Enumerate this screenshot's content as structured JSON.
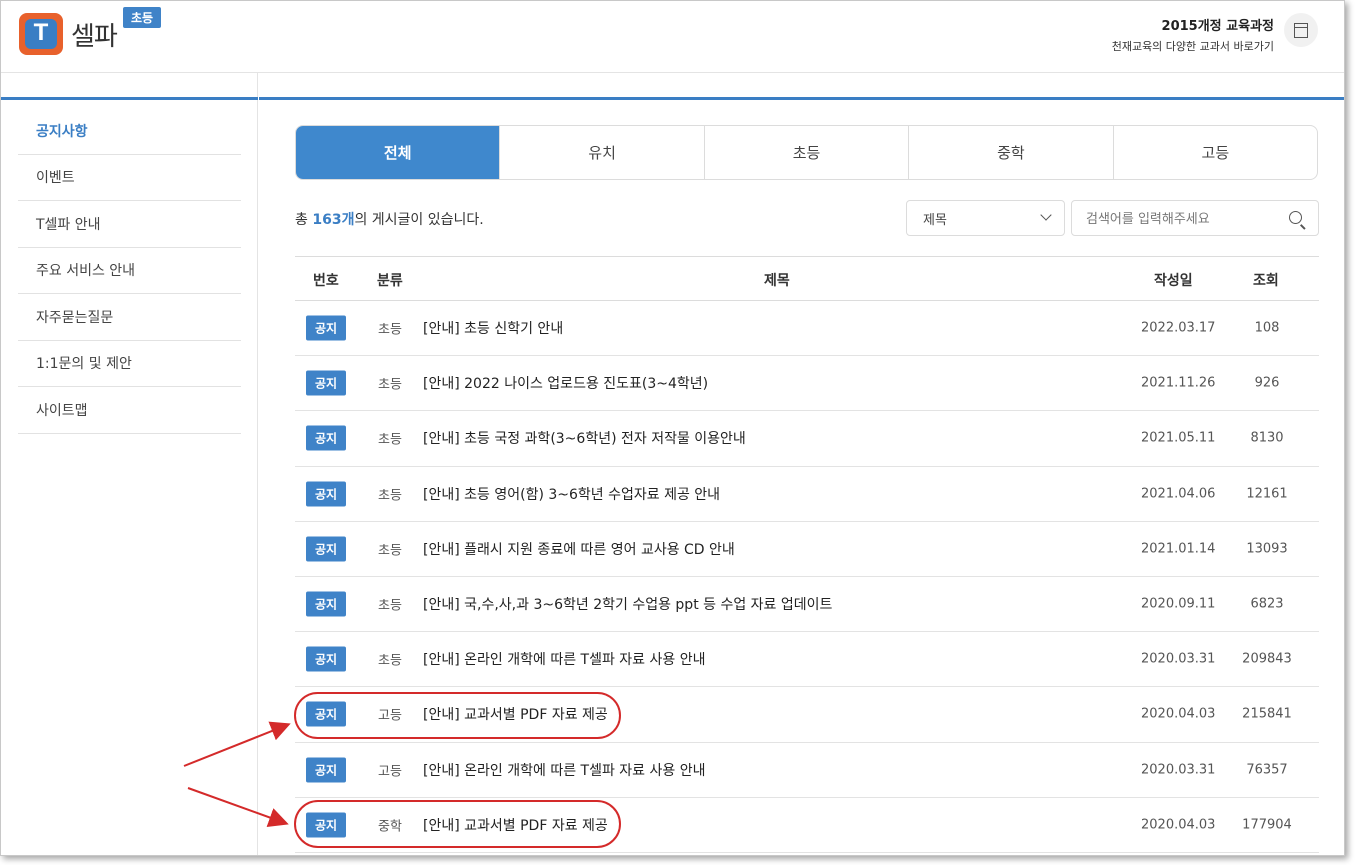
{
  "header": {
    "logo_letter": "T",
    "logo_text": "셀파",
    "level_badge": "초등",
    "curriculum_title": "2015개정 교육과정",
    "curriculum_sub": "천재교육의 다양한 교과서 바로가기"
  },
  "sidebar": {
    "items": [
      {
        "label": "공지사항",
        "active": true
      },
      {
        "label": "이벤트"
      },
      {
        "label": "T셀파 안내"
      },
      {
        "label": "주요 서비스 안내"
      },
      {
        "label": "자주묻는질문"
      },
      {
        "label": "1:1문의 및 제안"
      },
      {
        "label": "사이트맵"
      }
    ]
  },
  "tabs": [
    {
      "label": "전체",
      "active": true
    },
    {
      "label": "유치"
    },
    {
      "label": "초등"
    },
    {
      "label": "중학"
    },
    {
      "label": "고등"
    }
  ],
  "summary": {
    "prefix": "총 ",
    "count": "163개",
    "suffix": "의 게시글이 있습니다."
  },
  "filter": {
    "selected": "제목"
  },
  "search": {
    "placeholder": "검색어를 입력해주세요"
  },
  "table": {
    "headers": {
      "no": "번호",
      "category": "분류",
      "title": "제목",
      "date": "작성일",
      "views": "조회"
    },
    "rows": [
      {
        "badge": "공지",
        "category": "초등",
        "title": "[안내] 초등 신학기 안내",
        "date": "2022.03.17",
        "views": "108"
      },
      {
        "badge": "공지",
        "category": "초등",
        "title": "[안내] 2022 나이스 업로드용 진도표(3~4학년)",
        "date": "2021.11.26",
        "views": "926"
      },
      {
        "badge": "공지",
        "category": "초등",
        "title": "[안내] 초등 국정 과학(3~6학년) 전자 저작물 이용안내",
        "date": "2021.05.11",
        "views": "8130"
      },
      {
        "badge": "공지",
        "category": "초등",
        "title": "[안내] 초등 영어(함) 3~6학년 수업자료 제공 안내",
        "date": "2021.04.06",
        "views": "12161"
      },
      {
        "badge": "공지",
        "category": "초등",
        "title": "[안내] 플래시 지원 종료에 따른 영어 교사용 CD 안내",
        "date": "2021.01.14",
        "views": "13093"
      },
      {
        "badge": "공지",
        "category": "초등",
        "title": "[안내] 국,수,사,과 3~6학년 2학기 수업용 ppt 등 수업 자료 업데이트",
        "date": "2020.09.11",
        "views": "6823"
      },
      {
        "badge": "공지",
        "category": "초등",
        "title": "[안내] 온라인 개학에 따른 T셀파 자료 사용 안내",
        "date": "2020.03.31",
        "views": "209843"
      },
      {
        "badge": "공지",
        "category": "고등",
        "title": "[안내] 교과서별 PDF 자료 제공",
        "date": "2020.04.03",
        "views": "215841"
      },
      {
        "badge": "공지",
        "category": "고등",
        "title": "[안내] 온라인 개학에 따른 T셀파 자료 사용 안내",
        "date": "2020.03.31",
        "views": "76357"
      },
      {
        "badge": "공지",
        "category": "중학",
        "title": "[안내] 교과서별 PDF 자료 제공",
        "date": "2020.04.03",
        "views": "177904"
      }
    ]
  },
  "colors": {
    "accent": "#3a7ec4",
    "annotation": "#d42a2a",
    "logo_orange": "#e8612c"
  }
}
